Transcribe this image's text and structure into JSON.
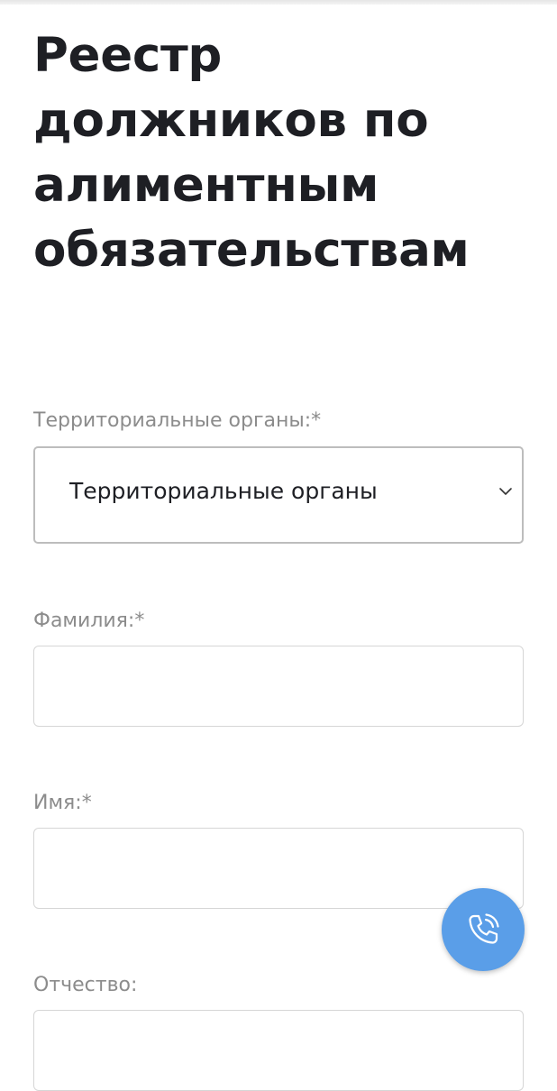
{
  "page": {
    "title": "Реестр должников по алиментным обязательствам"
  },
  "form": {
    "territorial": {
      "label": "Территориальные органы:*",
      "selected": "Территориальные органы"
    },
    "surname": {
      "label": "Фамилия:*",
      "value": ""
    },
    "name": {
      "label": "Имя:*",
      "value": ""
    },
    "patronymic": {
      "label": "Отчество:",
      "value": ""
    }
  },
  "icons": {
    "select_arrow": "chevron-down-icon",
    "call": "phone-icon"
  },
  "colors": {
    "call_button": "#5a9ee8",
    "title_text": "#1e1f24",
    "label_text": "#8c8c8c"
  }
}
